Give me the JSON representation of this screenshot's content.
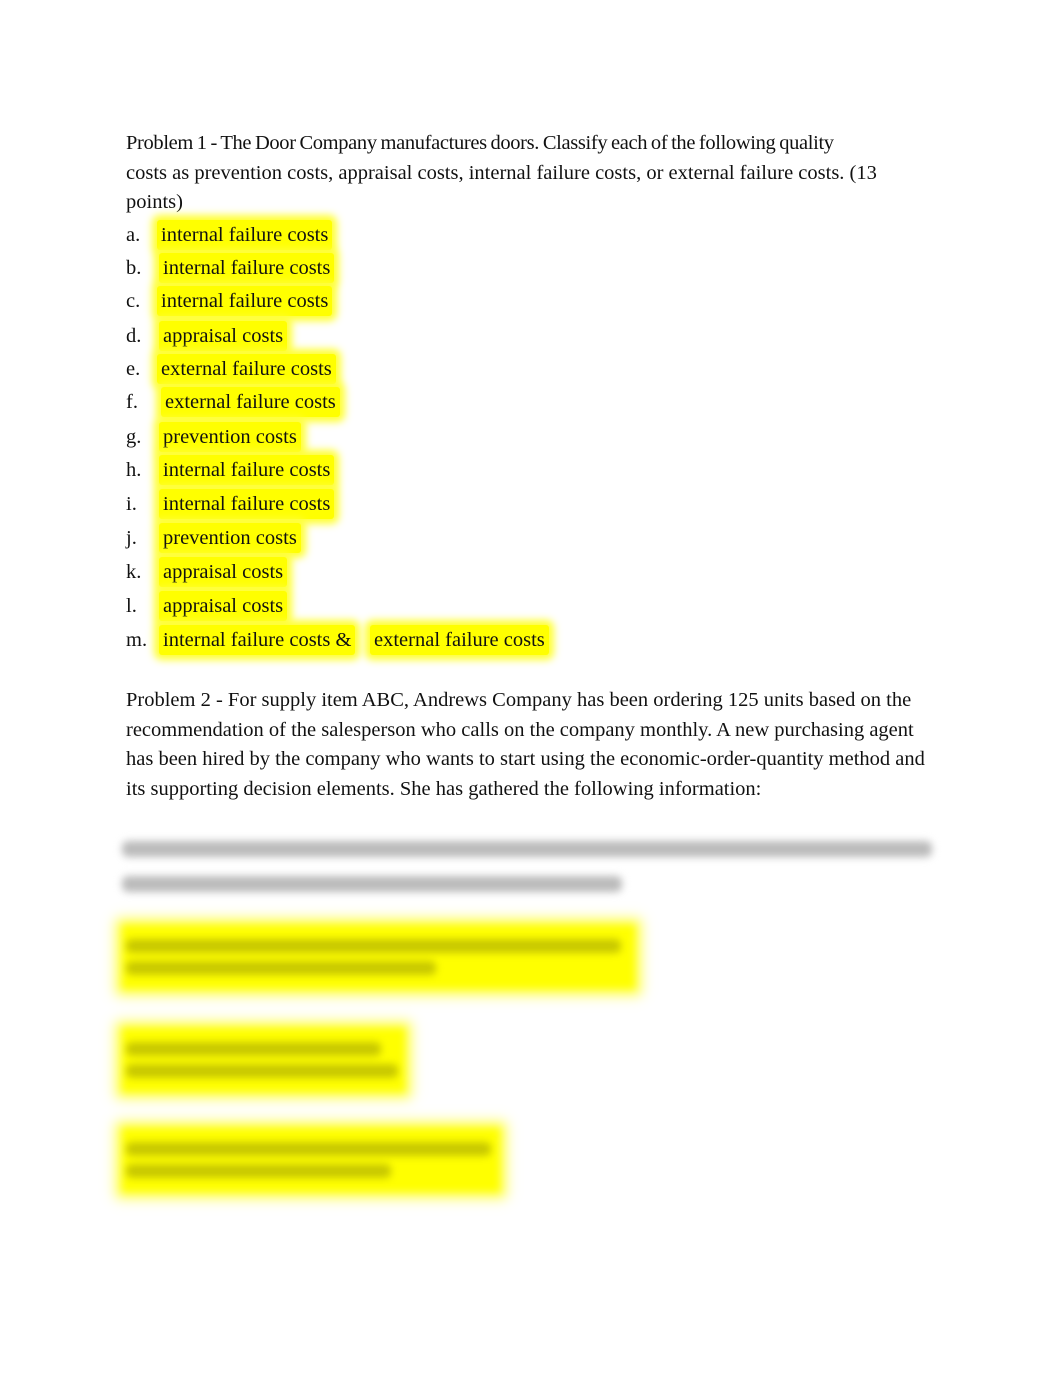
{
  "problem1": {
    "line1": "Problem 1 - The Door Company manufactures doors.  Classify each of the following quality",
    "line2": "costs as prevention costs, appraisal costs, internal failure costs, or external failure costs. (13",
    "line3": "points)",
    "answers": [
      {
        "label": "a.",
        "answer": "internal failure costs"
      },
      {
        "label": "b.",
        "answer": "internal failure costs"
      },
      {
        "label": "c.",
        "answer": "internal failure costs"
      },
      {
        "label": "d.",
        "answer": "appraisal costs"
      },
      {
        "label": "e.",
        "answer": "external failure costs"
      },
      {
        "label": "f.",
        "answer": "external failure costs"
      },
      {
        "label": "g.",
        "answer": "prevention costs"
      },
      {
        "label": "h.",
        "answer": "internal failure costs"
      },
      {
        "label": "i.",
        "answer": "internal failure costs"
      },
      {
        "label": "j.",
        "answer": "prevention costs"
      },
      {
        "label": "k.",
        "answer": "appraisal costs"
      },
      {
        "label": "l.",
        "answer": "appraisal costs"
      },
      {
        "label": "m.",
        "answer": "internal failure costs &",
        "answer2": "external failure costs"
      }
    ]
  },
  "problem2": {
    "line1": "Problem 2 -  For supply item ABC, Andrews Company has been ordering 125 units based on the",
    "line2": "recommendation of the salesperson who calls on the company monthly.  A new purchasing agent",
    "line3": "has been hired by the company who wants to start using the economic-order-quantity method and",
    "line4": "its supporting decision elements.  She has gathered the following information:"
  },
  "highlight_color": "#ffff00"
}
